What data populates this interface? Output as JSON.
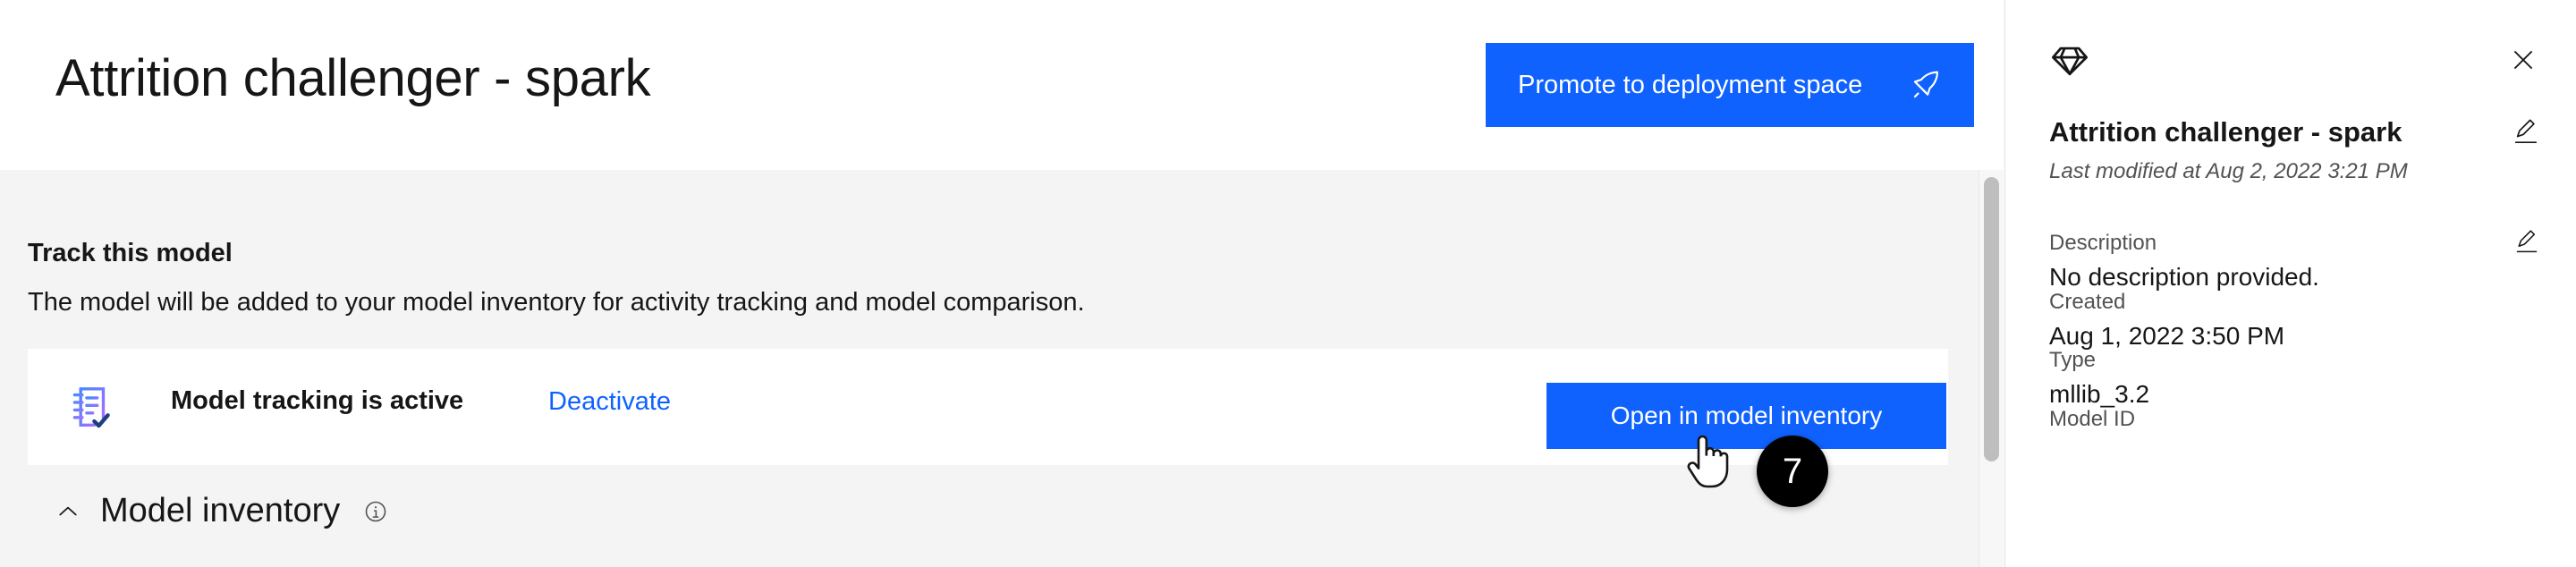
{
  "header": {
    "title": "Attrition challenger - spark",
    "promote_button": {
      "label": "Promote to deployment space",
      "icon": "rocket-icon"
    }
  },
  "main": {
    "track_section": {
      "heading": "Track this model",
      "subtext": "The model will be added to your model inventory for activity tracking and model comparison.",
      "status_icon": "tracking-checklist-icon",
      "status_label": "Model tracking is active",
      "deactivate_label": "Deactivate",
      "open_inventory_label": "Open in model inventory"
    },
    "accordion": {
      "chevron": "chevron-up-icon",
      "title": "Model inventory",
      "info_icon": "information-icon"
    }
  },
  "side_panel": {
    "gem_icon": "gem-icon",
    "close_icon": "close-icon",
    "title": "Attrition challenger - spark",
    "title_edit_icon": "edit-pencil-icon",
    "last_modified": "Last modified at Aug 2, 2022 3:21 PM",
    "fields": [
      {
        "label": "Description",
        "value": "No description provided.",
        "edit_icon": "edit-pencil-icon"
      },
      {
        "label": "Created",
        "value": "Aug 1, 2022 3:50 PM"
      },
      {
        "label": "Type",
        "value": "mllib_3.2"
      },
      {
        "label": "Model ID",
        "value": ""
      }
    ]
  },
  "overlay": {
    "cursor": "pointer-hand-cursor",
    "step_number": "7"
  },
  "colors": {
    "accent_blue": "#0f62fe",
    "page_bg": "#f4f4f4",
    "card_bg": "#ffffff",
    "text_primary": "#161616",
    "text_secondary": "#525252",
    "badge_bg": "#000000"
  }
}
